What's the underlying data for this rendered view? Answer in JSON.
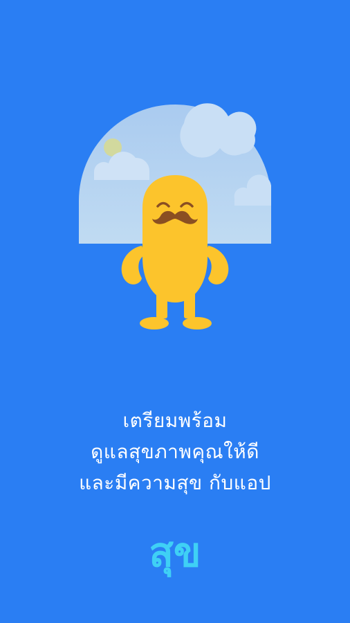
{
  "splash": {
    "tagline": {
      "line1": "เตรียมพร้อม",
      "line2": "ดูแลสุขภาพคุณให้ดี",
      "line3": "และมีความสุข กับแอป"
    },
    "app_name": "สุข",
    "illustration": "mustached-mascot-under-sky-dome"
  },
  "colors": {
    "background": "#2a7ef3",
    "sky": "#b5d3f0",
    "mascot": "#fcc42c",
    "mustache": "#8a4f22",
    "wordmark": "#3fd0f5"
  }
}
